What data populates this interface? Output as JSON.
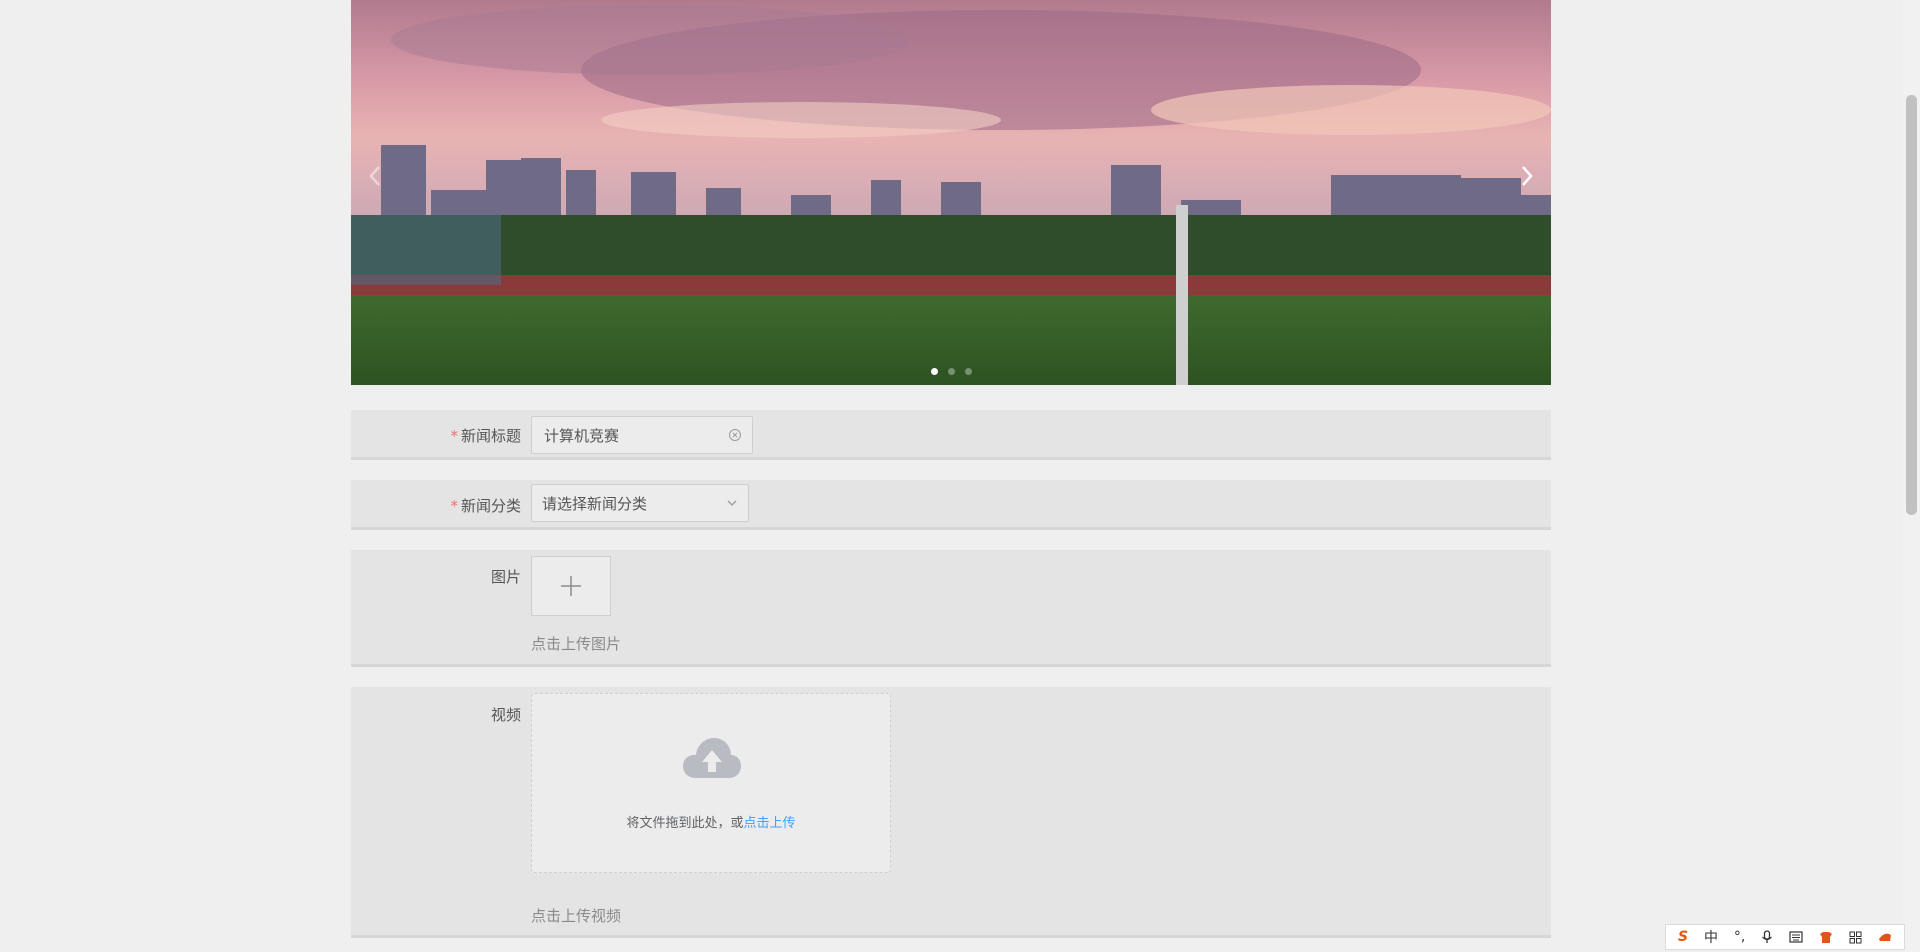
{
  "form": {
    "title": {
      "label": "新闻标题",
      "value": "计算机竞赛",
      "required_mark": "*"
    },
    "category": {
      "label": "新闻分类",
      "placeholder": "请选择新闻分类",
      "required_mark": "*"
    },
    "image": {
      "label": "图片",
      "hint": "点击上传图片"
    },
    "video": {
      "label": "视频",
      "drag_text": "将文件拖到此处，或",
      "drag_link": "点击上传",
      "hint": "点击上传视频"
    }
  },
  "carousel": {
    "slide_count": 3,
    "active_index": 0,
    "left_arrow_icon": "chevron-left-icon",
    "right_arrow_icon": "chevron-right-icon"
  },
  "ime_toolbar": {
    "logo_text": "S",
    "lang": "中",
    "punct": "°,"
  },
  "colors": {
    "required": "#f56c6c",
    "link": "#409eff",
    "row_bg": "#e4e4e4"
  }
}
